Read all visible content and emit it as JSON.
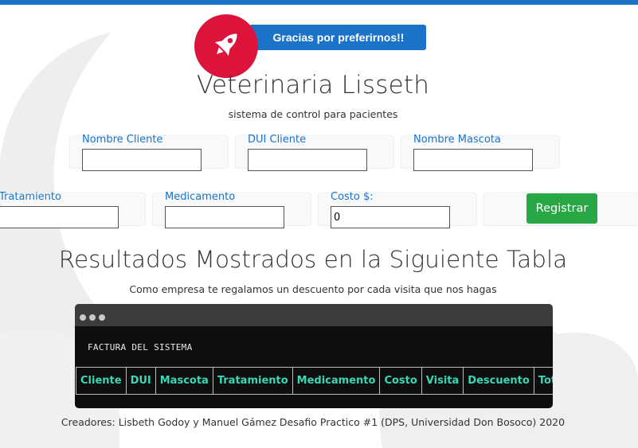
{
  "header": {
    "thanks_button": "Gracias por preferirnos!!",
    "title": "Veterinaria Lisseth",
    "subtitle": "sistema de control para pacientes",
    "logo_icon": "rocket-icon",
    "colors": {
      "accent": "#1a73c9",
      "logo": "#dc143c"
    }
  },
  "form": {
    "cliente_label": "Nombre Cliente",
    "cliente_value": "",
    "dui_label": "DUI Cliente",
    "dui_value": "",
    "mascota_label": "Nombre Mascota",
    "mascota_value": "",
    "tratamiento_label": "Tratamiento",
    "tratamiento_value": "",
    "medicamento_label": "Medicamento",
    "medicamento_value": "",
    "costo_label": "Costo $:",
    "costo_value": "0",
    "register_button": "Registrar",
    "register_color": "#28a745"
  },
  "results": {
    "title": "Resultados Mostrados en la Siguiente Tabla",
    "subtitle": "Como empresa te regalamos un descuento por cada visita que nos hagas",
    "terminal_text": "FACTURA DEL SISTEMA",
    "table_headers": [
      "Cliente",
      "DUI",
      "Mascota",
      "Tratamiento",
      "Medicamento",
      "Costo",
      "Visita",
      "Descuento",
      "Total"
    ],
    "header_color": "#3ad7b6"
  },
  "footer": {
    "credits": "Creadores: Lisbeth Godoy y Manuel Gámez Desafio Practico #1 (DPS, Universidad Don Bosoco) 2020"
  }
}
